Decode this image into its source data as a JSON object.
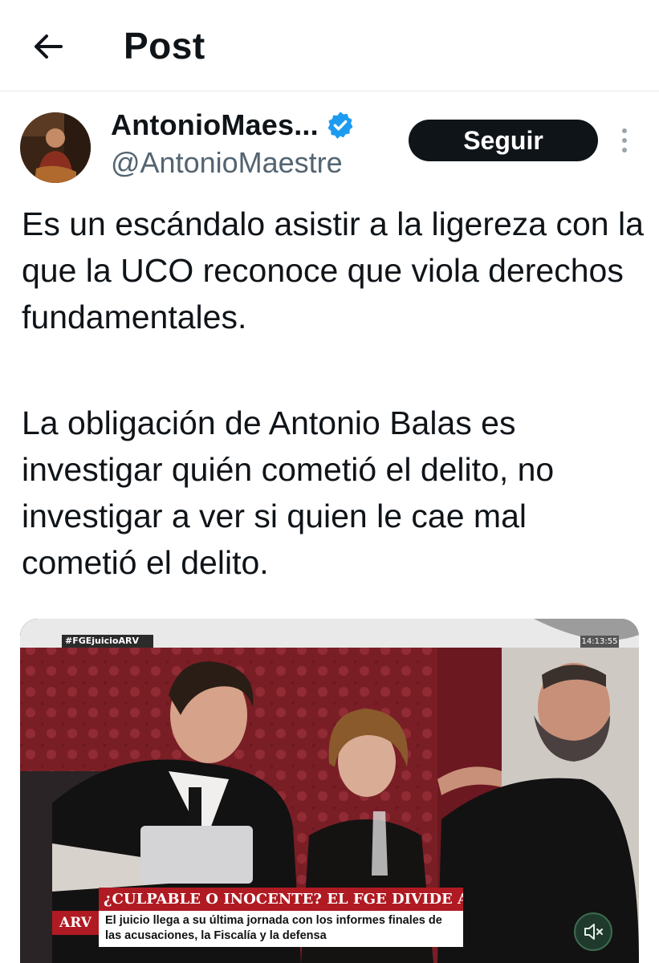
{
  "header": {
    "title": "Post"
  },
  "author": {
    "name": "AntonioMaes...",
    "handle": "@AntonioMaestre",
    "verified": true,
    "follow_label": "Seguir"
  },
  "post": {
    "paragraph_1": "Es un escándalo asistir a la ligereza con la que la UCO reconoce que viola derechos fundamentales.",
    "paragraph_2": "La obligación de Antonio Balas es investigar quién cometió el delito, no investigar a ver si quien le cae mal cometió el delito."
  },
  "media": {
    "hashtag": "#FGEjuicioARV",
    "clock": "14:13:55",
    "headline": "¿CULPABLE O INOCENTE? EL FGE DIVIDE A ESPAÑA",
    "subheadline": "El juicio llega a su última jornada con los informes finales de las acusaciones, la Fiscalía y la defensa",
    "channel_logo": "ARV"
  },
  "colors": {
    "accent": "#1d9bf0",
    "text": "#0f1419",
    "secondary_text": "#536471",
    "button_bg": "#0f1419",
    "banner_red": "#b01a22"
  }
}
